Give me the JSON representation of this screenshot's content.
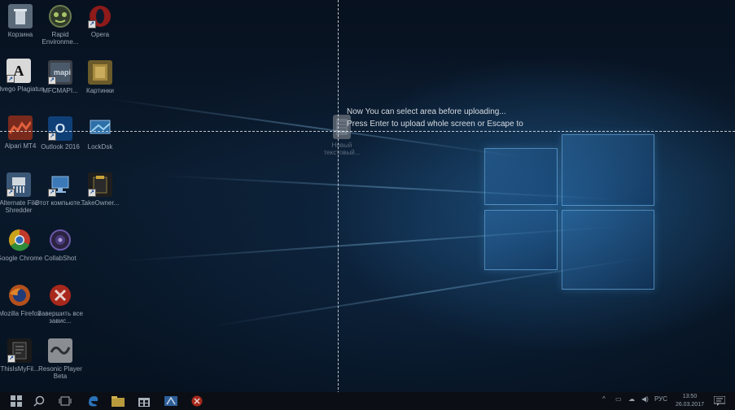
{
  "overlay": {
    "line1": "Now You can select area before uploading...",
    "line2": "Press Enter to upload whole screen or Escape to"
  },
  "desktop_icons": {
    "recycle_bin": "Корзина",
    "rapid_env": "Rapid Environme...",
    "opera": "Opera",
    "advego": "Advego Plagiatus",
    "mfcmapi": "MFCMAPI...",
    "pictures": "Картинки",
    "alpari": "Alpari MT4",
    "outlook": "Outlook 2016",
    "lockdsk": "LockDsk",
    "new_text": "Новый текстовый...",
    "alt_shredder": "Alternate File Shredder",
    "this_pc": "Этот компьюте...",
    "takeowner": "TakeOwner...",
    "chrome": "Google Chrome",
    "collabshot": "CollabShot",
    "firefox": "Mozilla Firefox",
    "end_tasks": "Завершить все завис...",
    "thisismyfile": "ThisIsMyFil...",
    "resonic": "Resonic Player Beta"
  },
  "taskbar": {
    "language": "РУС",
    "time": "13:50",
    "date": "26.03.2017"
  },
  "icons": {
    "start": "windows-start-icon",
    "search": "search-icon",
    "task_view": "task-view-icon",
    "edge": "edge-icon",
    "explorer": "file-explorer-icon",
    "store": "store-icon",
    "app1": "app-icon",
    "app2": "stop-icon",
    "notifications": "notification-icon"
  },
  "colors": {
    "accent": "#2e86d6",
    "overlay_text": "#d6dce2",
    "taskbar": "#0b0f15"
  }
}
